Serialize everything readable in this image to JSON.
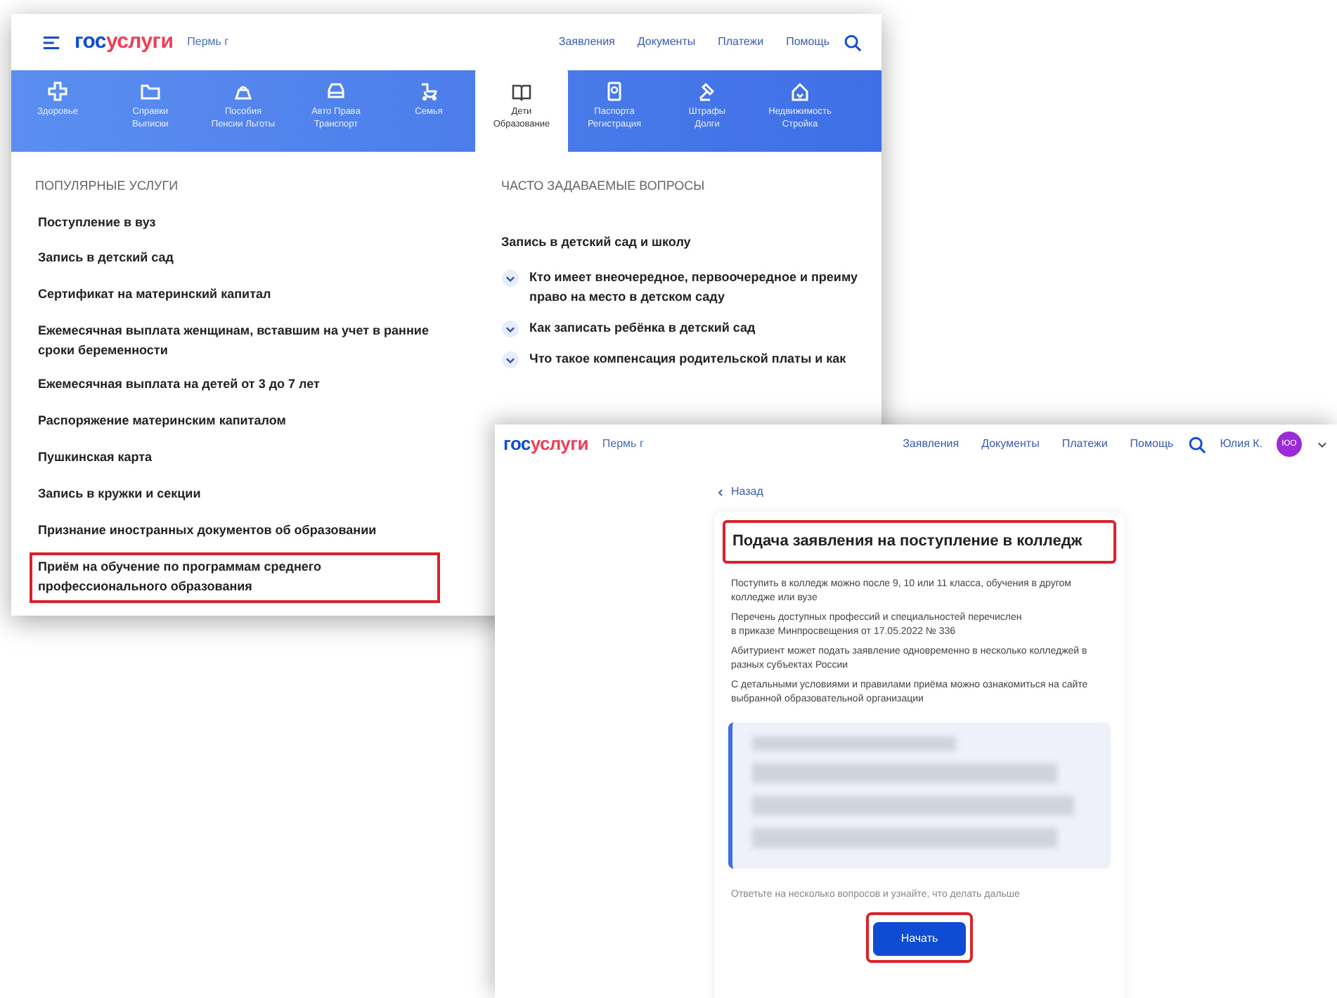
{
  "back_window": {
    "logo_dark": "гос",
    "logo_red": "услуги",
    "city": "Пермь г",
    "nav": [
      "Заявления",
      "Документы",
      "Платежи",
      "Помощь"
    ],
    "tabs": [
      {
        "lines": [
          "Здоровье"
        ],
        "selected": false
      },
      {
        "lines": [
          "Справки",
          "Выписки"
        ],
        "selected": false
      },
      {
        "lines": [
          "Пособия",
          "Пенсии Льготы"
        ],
        "selected": false
      },
      {
        "lines": [
          "Авто Права",
          "Транспорт"
        ],
        "selected": false
      },
      {
        "lines": [
          "Семья"
        ],
        "selected": false
      },
      {
        "lines": [
          "Дети",
          "Образование"
        ],
        "selected": true
      },
      {
        "lines": [
          "Паспорта",
          "Регистрация"
        ],
        "selected": false
      },
      {
        "lines": [
          "Штрафы",
          "Долги"
        ],
        "selected": false
      },
      {
        "lines": [
          "Недвижимость",
          "Стройка"
        ],
        "selected": false
      }
    ],
    "popular_heading": "ПОПУЛЯРНЫЕ УСЛУГИ",
    "popular_services": [
      {
        "text": "Поступление в вуз",
        "highlighted": false
      },
      {
        "text": "Запись в детский сад",
        "highlighted": false
      },
      {
        "text": "Сертификат на материнский капитал",
        "highlighted": false
      },
      {
        "text": "Ежемесячная выплата женщинам, вставшим на учет в ранние сроки беременности",
        "highlighted": false
      },
      {
        "text": "Ежемесячная выплата на детей от 3 до 7 лет",
        "highlighted": false
      },
      {
        "text": "Распоряжение материнским капиталом",
        "highlighted": false
      },
      {
        "text": "Пушкинская карта",
        "highlighted": false
      },
      {
        "text": "Запись в кружки и секции",
        "highlighted": false
      },
      {
        "text": "Признание иностранных документов об образовании",
        "highlighted": false
      },
      {
        "text": "Приём на обучение по программам среднего профессионального образования",
        "highlighted": true
      }
    ],
    "faq_heading": "ЧАСТО ЗАДАВАЕМЫЕ ВОПРОСЫ",
    "faq_group": "Запись в детский сад и школу",
    "faq_items": [
      {
        "lines": [
          "Кто имеет внеочередное, первоочередное и преиму",
          "право на место в детском саду"
        ]
      },
      {
        "lines": [
          "Как записать ребёнка в детский сад"
        ]
      },
      {
        "lines": [
          "Что такое компенсация родительской платы и как"
        ]
      }
    ]
  },
  "front_window": {
    "logo_dark": "гос",
    "logo_red": "услуги",
    "city": "Пермь г",
    "nav": [
      "Заявления",
      "Документы",
      "Платежи",
      "Помощь"
    ],
    "user_name": "Юлия К.",
    "avatar_initials": "ЮО",
    "back_link": "Назад",
    "title": "Подача заявления на поступление в колледж",
    "title_highlighted": true,
    "paragraphs": [
      {
        "text": "Поступить в колледж можно после 9, 10 или 11 класса, обучения в другом колледже или вузе"
      },
      {
        "text": "Перечень доступных профессий и специальностей перечислен",
        "link": "в приказе Минпросвещения от 17.05.2022 № 336"
      },
      {
        "text": "Абитуриент может подать заявление одновременно в несколько колледжей в разных субъектах России"
      },
      {
        "text": "С детальными условиями и правилами приёма можно ознакомиться на сайте выбранной образовательной организации"
      }
    ],
    "hint": "Ответьте на несколько вопросов и узнайте, что делать дальше",
    "start_button": {
      "label": "Начать",
      "highlighted": true
    }
  }
}
